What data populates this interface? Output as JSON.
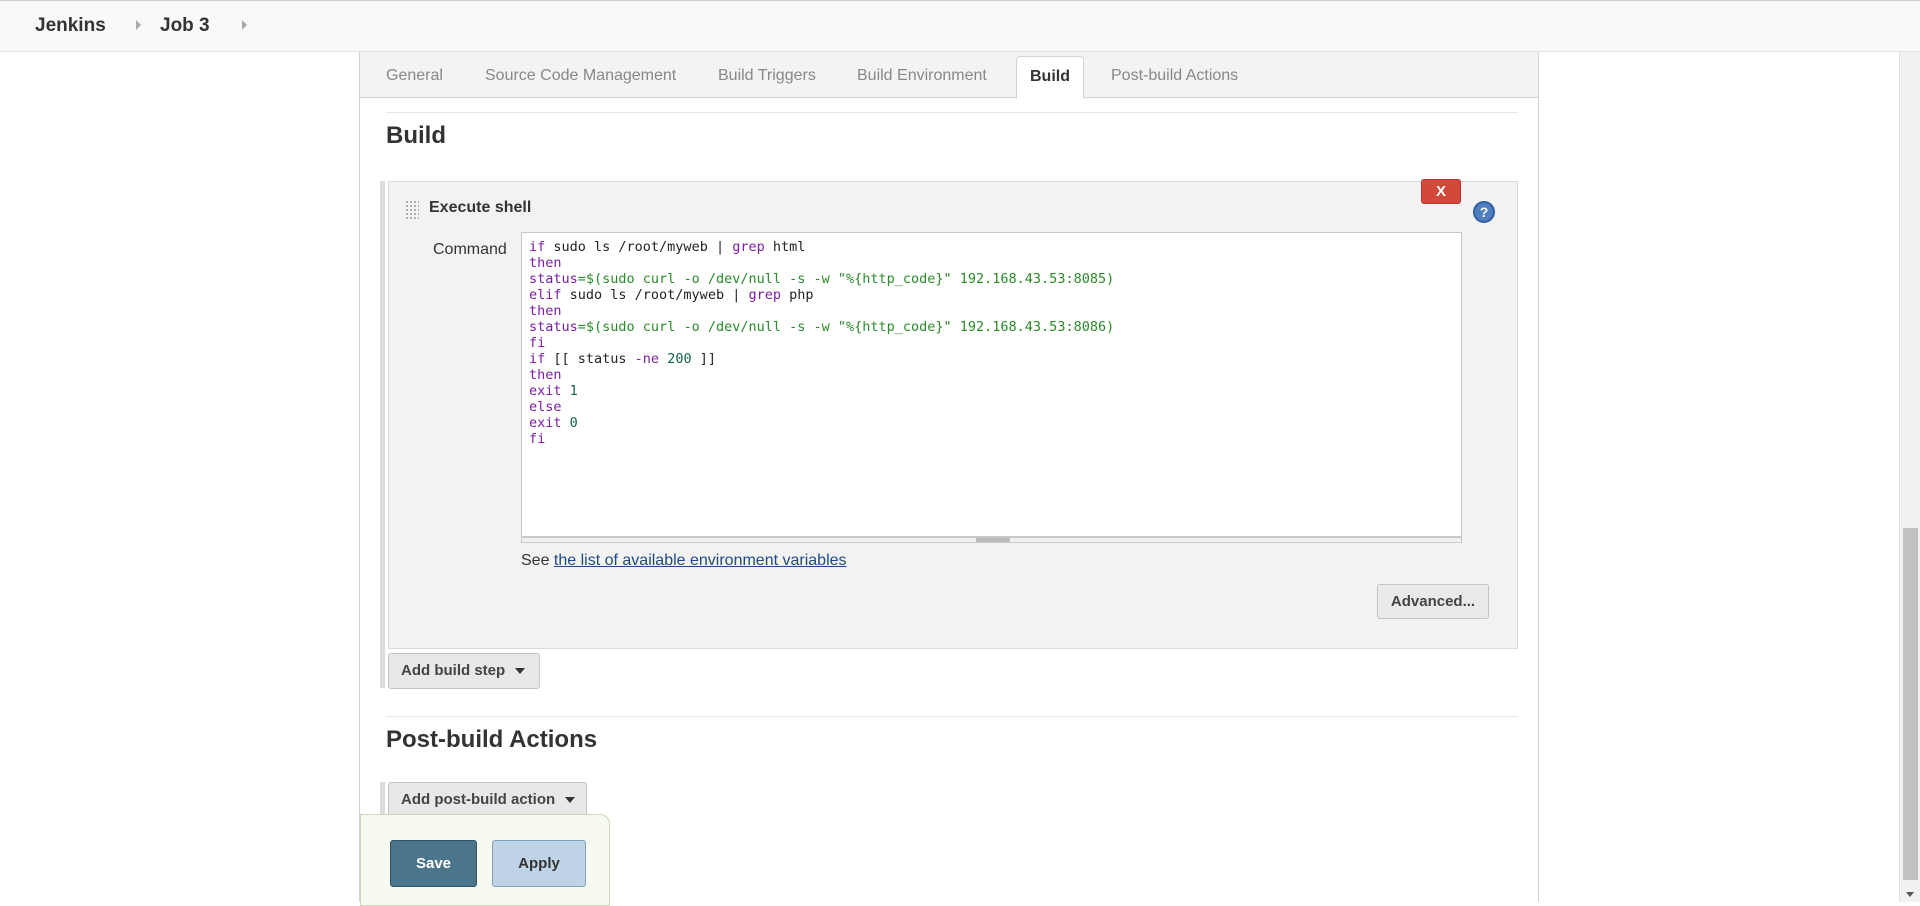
{
  "breadcrumb": {
    "items": [
      "Jenkins",
      "Job 3"
    ]
  },
  "tabs": [
    {
      "label": "General",
      "active": false
    },
    {
      "label": "Source Code Management",
      "active": false
    },
    {
      "label": "Build Triggers",
      "active": false
    },
    {
      "label": "Build Environment",
      "active": false
    },
    {
      "label": "Build",
      "active": true
    },
    {
      "label": "Post-build Actions",
      "active": false
    }
  ],
  "build_section": {
    "title": "Build",
    "step": {
      "title": "Execute shell",
      "delete_label": "X",
      "help_label": "?",
      "command_label": "Command",
      "command_lines": [
        "if sudo ls /root/myweb | grep html",
        "then",
        "status=$(sudo curl -o /dev/null -s -w \"%{http_code}\" 192.168.43.53:8085)",
        "elif sudo ls /root/myweb | grep php",
        "then",
        "status=$(sudo curl -o /dev/null -s -w \"%{http_code}\" 192.168.43.53:8086)",
        "fi",
        "if [[ status -ne 200 ]]",
        "then",
        "exit 1",
        "else",
        "exit 0",
        "fi"
      ],
      "see_prefix": "See",
      "see_link": "the list of available environment variables",
      "advanced_label": "Advanced..."
    },
    "add_step_label": "Add build step"
  },
  "post_build_section": {
    "title": "Post-build Actions",
    "add_action_label": "Add post-build action"
  },
  "footer": {
    "save_label": "Save",
    "apply_label": "Apply"
  },
  "colors": {
    "save_button": "#4b758b",
    "apply_button": "#bed3e6",
    "delete_button": "#d24939",
    "link": "#204a87",
    "keyword": "#7a1fa2",
    "string": "#2a8a2a"
  }
}
